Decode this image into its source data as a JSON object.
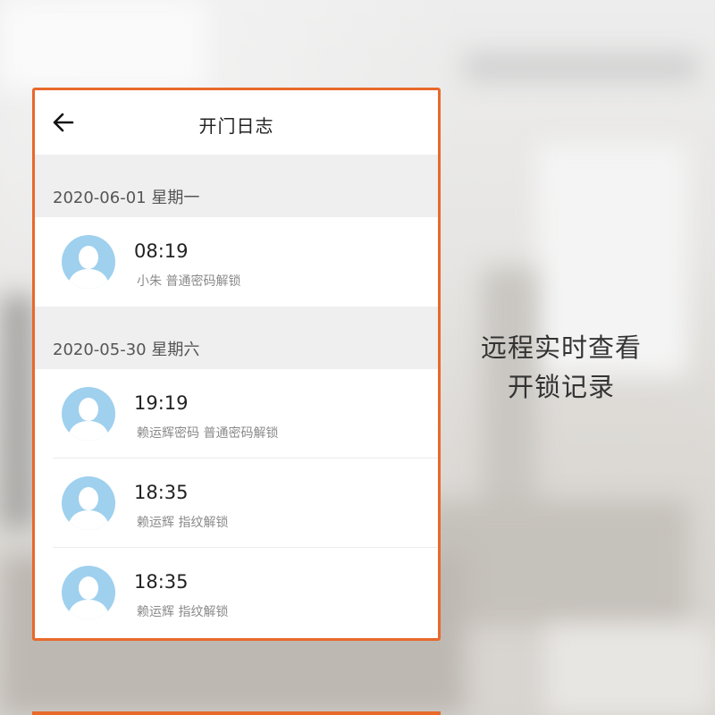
{
  "header": {
    "title": "开门日志",
    "back_icon": "arrow-left-icon"
  },
  "theme": {
    "accent": "#e8692a",
    "avatar": "#9fd0ee",
    "section_bg": "#efefef"
  },
  "groups": [
    {
      "date": "2020-06-01 星期一",
      "entries": [
        {
          "time": "08:19",
          "desc": "小朱 普通密码解锁"
        }
      ]
    },
    {
      "date": "2020-05-30 星期六",
      "entries": [
        {
          "time": "19:19",
          "desc": "赖运辉密码 普通密码解锁"
        },
        {
          "time": "18:35",
          "desc": "赖运辉 指纹解锁"
        },
        {
          "time": "18:35",
          "desc": "赖运辉 指纹解锁"
        }
      ]
    }
  ],
  "tagline": {
    "line1": "远程实时查看",
    "line2": "开锁记录"
  }
}
